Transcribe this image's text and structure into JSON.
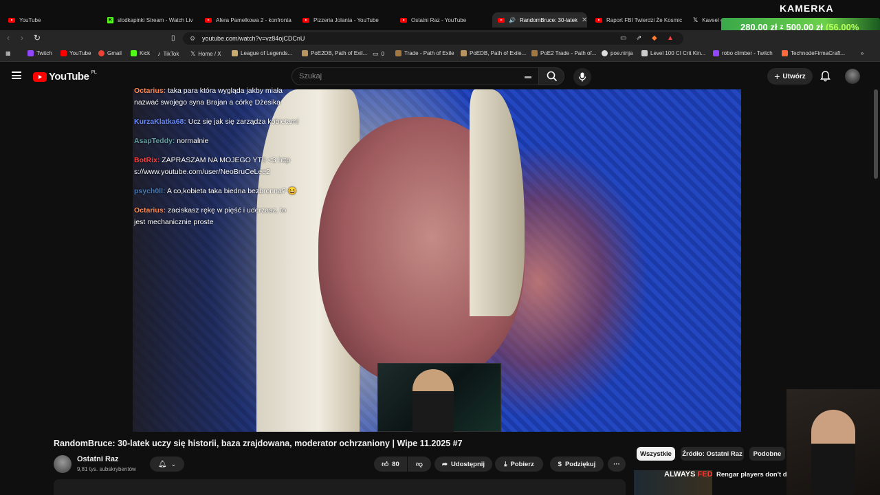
{
  "tabs": [
    {
      "label": "YouTube",
      "icon": "youtube-icon"
    },
    {
      "label": "slodkapinki Stream - Watch Liv",
      "icon": "kick-icon"
    },
    {
      "label": "Afera Pamelkowa 2 - konfronta",
      "icon": "youtube-icon"
    },
    {
      "label": "Pizzeria Jolanta - YouTube",
      "icon": "youtube-icon"
    },
    {
      "label": "Ostatni Raz - YouTube",
      "icon": "youtube-icon"
    },
    {
      "label": "RandomBruce: 30-latek",
      "icon": "youtube-icon",
      "active": true
    },
    {
      "label": "Raport FBI Twierdzi Że Kosmic",
      "icon": "youtube-icon"
    },
    {
      "label": "Kaveel c",
      "icon": "x-icon"
    }
  ],
  "overlay": {
    "kamerka": "KAMERKA",
    "donation_current": "280,00 zł",
    "donation_sep": "z",
    "donation_goal": "500,00 zł",
    "donation_pct": "(56.00%"
  },
  "address": {
    "url": "youtube.com/watch?v=vz84ojCDCnU"
  },
  "bookmarks": [
    {
      "label": "Twitch",
      "color": "#9146ff"
    },
    {
      "label": "YouTube",
      "color": "#ff0000"
    },
    {
      "label": "Gmail",
      "color": "#ea4335"
    },
    {
      "label": "Kick",
      "color": "#53fc18"
    },
    {
      "label": "TikTok",
      "color": "#ffffff"
    },
    {
      "label": "Home / X",
      "color": "#ffffff"
    },
    {
      "label": "League of Legends...",
      "color": "#c8aa6e"
    },
    {
      "label": "PoE2DB, Path of Exil...",
      "color": "#b89560"
    },
    {
      "label": "0",
      "color": "#888888"
    },
    {
      "label": "Trade - Path of Exile",
      "color": "#a07840"
    },
    {
      "label": "PoEDB, Path of Exile...",
      "color": "#b89560"
    },
    {
      "label": "PoE2 Trade - Path of...",
      "color": "#a07840"
    },
    {
      "label": "poe.ninja",
      "color": "#dddddd"
    },
    {
      "label": "Level 100 CI Crit Kin...",
      "color": "#cccccc"
    },
    {
      "label": "robo climber - Twitch",
      "color": "#9146ff"
    },
    {
      "label": "TechnodeFirmaCraft...",
      "color": "#ff6a3a"
    }
  ],
  "header": {
    "logo_text": "YouTube",
    "country": "PL",
    "search_placeholder": "Szukaj",
    "create_label": "Utwórz"
  },
  "chat": [
    {
      "user": "Octarius:",
      "color": "#ff8a50",
      "text": "taka para która wygląda jakby miała nazwać swojego syna Brajan a córkę Dżesika"
    },
    {
      "user": "KurzaKlatka68:",
      "color": "#6a8cff",
      "text": "Ucz się        jak się zarządza kobietami"
    },
    {
      "user": "AsapTeddy:",
      "color": "#5f9ea0",
      "text": "normalnie"
    },
    {
      "user": "BotRix:",
      "color": "#ff4040",
      "text": "ZAPRASZAM NA MOJEGO YT!! <3 https://www.youtube.com/user/NeoBruCeLee2"
    },
    {
      "user": "psych0ll:",
      "color": "#4a7ab0",
      "text": "A co,kobieta taka biedna bezbronna? 😆"
    },
    {
      "user": "Octarius:",
      "color": "#ff8a50",
      "text": "zaciskasz rękę w pięść i uderzasz, to jest mechanicznie proste"
    }
  ],
  "video": {
    "title": "RandomBruce: 30-latek uczy się historii, baza zrajdowana, moderator ochrzaniony | Wipe 11.2025 #7"
  },
  "channel": {
    "name": "Ostatni Raz",
    "subs": "9,81 tys. subskrybentów"
  },
  "actions": {
    "likes": "80",
    "share": "Udostępnij",
    "download": "Pobierz",
    "thanks": "Podziękuj"
  },
  "chips": {
    "all": "Wszystkie",
    "source": "Źródło: Ostatni Raz",
    "similar": "Podobne"
  },
  "recommended": {
    "thumb_text_a": "ALWAYS",
    "thumb_text_b": "FED",
    "title": "Rengar players don't do t"
  }
}
